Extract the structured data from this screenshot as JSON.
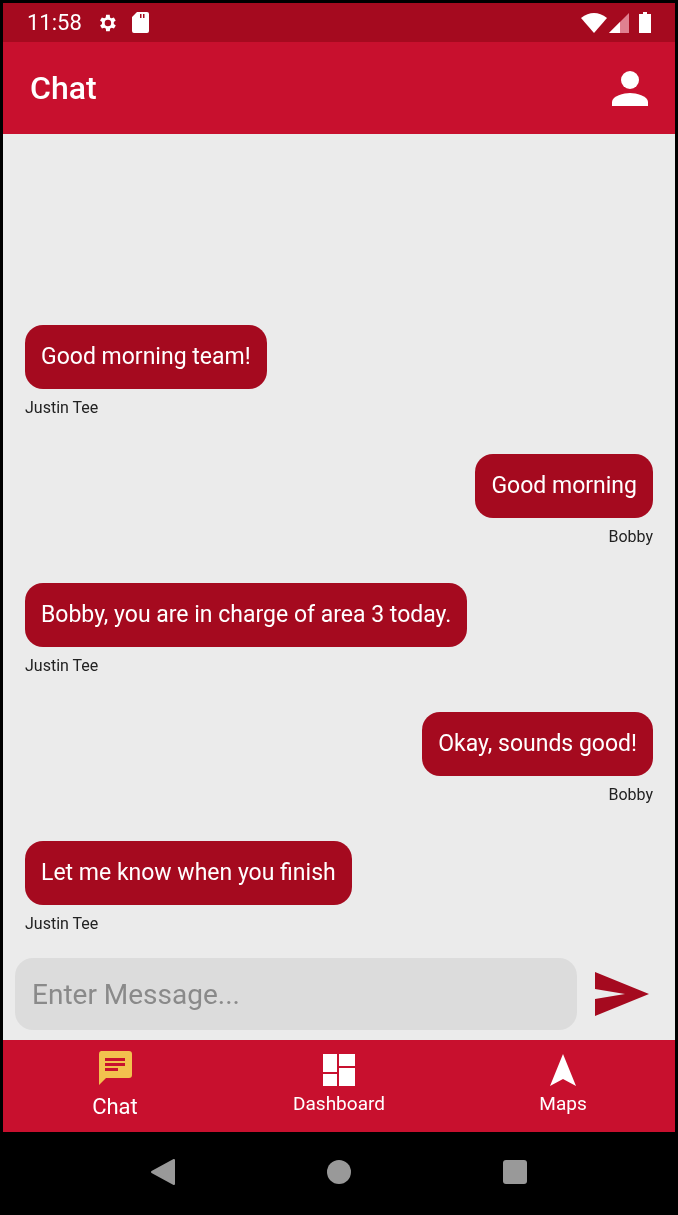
{
  "status_bar": {
    "time": "11:58"
  },
  "app_bar": {
    "title": "Chat"
  },
  "messages": [
    {
      "text": "Good morning team!",
      "sender": "Justin Tee",
      "outgoing": false
    },
    {
      "text": "Good morning",
      "sender": "Bobby",
      "outgoing": true
    },
    {
      "text": "Bobby, you are in charge of area 3 today.",
      "sender": "Justin Tee",
      "outgoing": false
    },
    {
      "text": "Okay, sounds good!",
      "sender": "Bobby",
      "outgoing": true
    },
    {
      "text": "Let me know when you finish",
      "sender": "Justin Tee",
      "outgoing": false
    }
  ],
  "composer": {
    "placeholder": "Enter Message..."
  },
  "bottom_nav": [
    {
      "kind": "chat",
      "label": "Chat",
      "selected": true
    },
    {
      "kind": "dashboard",
      "label": "Dashboard",
      "selected": false
    },
    {
      "kind": "maps",
      "label": "Maps",
      "selected": false
    }
  ]
}
